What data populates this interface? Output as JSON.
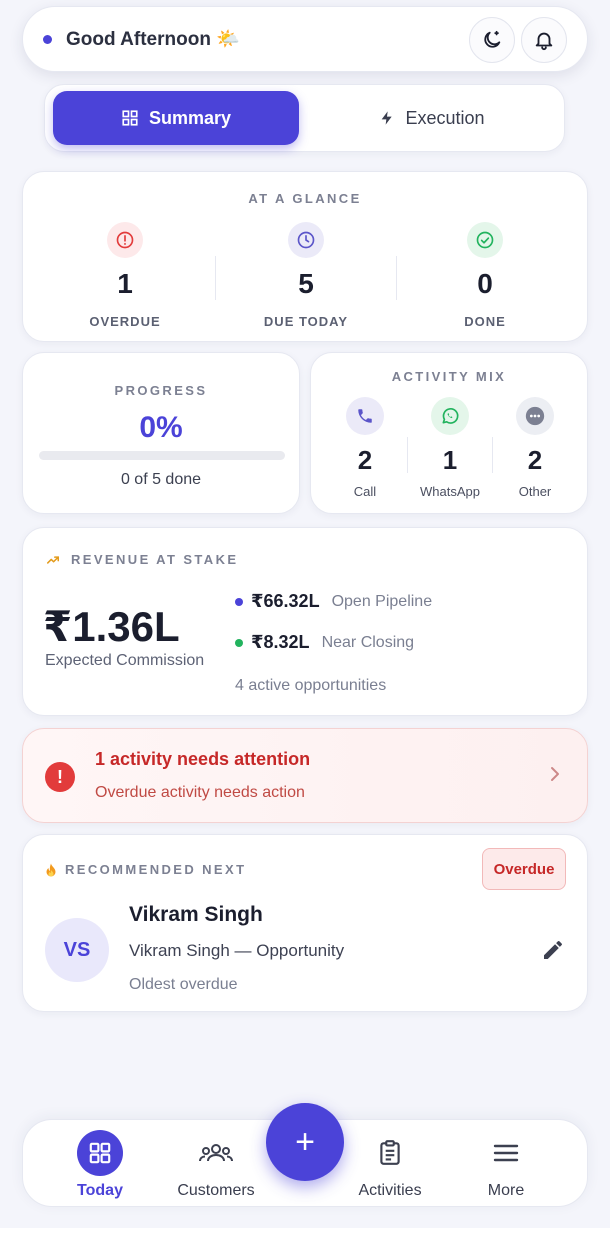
{
  "header": {
    "greeting": "Good Afternoon 🌤️"
  },
  "tabs": {
    "summary": "Summary",
    "execution": "Execution",
    "active": "summary"
  },
  "glance": {
    "title": "AT A GLANCE",
    "items": [
      {
        "value": "1",
        "label": "OVERDUE"
      },
      {
        "value": "5",
        "label": "DUE TODAY"
      },
      {
        "value": "0",
        "label": "DONE"
      }
    ]
  },
  "progress": {
    "title": "PROGRESS",
    "percent_text": "0%",
    "fraction": 0,
    "summary": "0 of 5 done"
  },
  "activity_mix": {
    "title": "ACTIVITY MIX",
    "items": [
      {
        "value": "2",
        "label": "Call"
      },
      {
        "value": "1",
        "label": "WhatsApp"
      },
      {
        "value": "2",
        "label": "Other"
      }
    ]
  },
  "revenue": {
    "title": "REVENUE AT STAKE",
    "amount": "₹1.36L",
    "amount_label": "Expected Commission",
    "lines": [
      {
        "value": "₹66.32L",
        "label": "Open Pipeline"
      },
      {
        "value": "₹8.32L",
        "label": "Near Closing"
      }
    ],
    "footer": "4 active opportunities"
  },
  "alert": {
    "title": "1 activity needs attention",
    "subtitle": "Overdue activity needs action"
  },
  "recommended": {
    "title": "RECOMMENDED NEXT",
    "badge": "Overdue",
    "initials": "VS",
    "name": "Vikram Singh",
    "opportunity": "Vikram Singh — Opportunity",
    "note": "Oldest overdue"
  },
  "nav": {
    "items": [
      {
        "label": "Today"
      },
      {
        "label": "Customers"
      },
      {
        "label": "Activities"
      },
      {
        "label": "More"
      }
    ],
    "fab": "+"
  },
  "colors": {
    "accent": "#4b43d8",
    "danger": "#e23b3b",
    "success": "#22b35e"
  }
}
